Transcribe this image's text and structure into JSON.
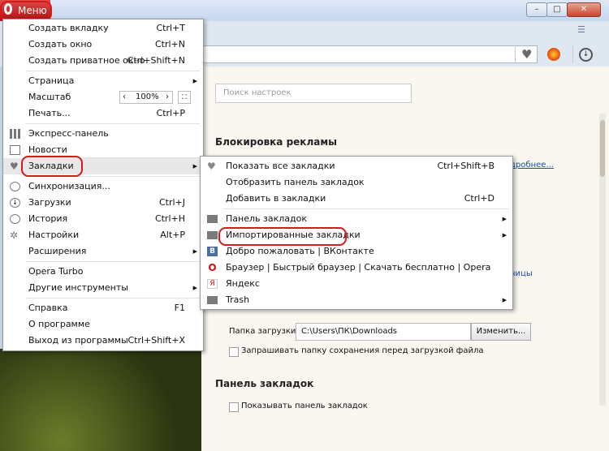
{
  "menu_button": {
    "label": "Меню"
  },
  "settings": {
    "search_placeholder": "Поиск настроек",
    "adblock_title": "Блокировка рекламы",
    "more_link": "Подробнее...",
    "frag_right": "ницы",
    "download_label": "Папка загрузки:",
    "download_path": "C:\\Users\\ПК\\Downloads",
    "change_button": "Изменить...",
    "ask_folder": "Запрашивать папку сохранения перед загрузкой файла",
    "bookmarks_panel_title": "Панель закладок",
    "show_bookmarks_panel": "Показывать панель закладок"
  },
  "main_menu": {
    "new_tab": "Создать вкладку",
    "new_tab_key": "Ctrl+T",
    "new_window": "Создать окно",
    "new_window_key": "Ctrl+N",
    "private_window": "Создать приватное окно",
    "private_window_key": "Ctrl+Shift+N",
    "page": "Страница",
    "zoom": "Масштаб",
    "zoom_value": "100%",
    "print": "Печать...",
    "print_key": "Ctrl+P",
    "speed_dial": "Экспресс-панель",
    "news": "Новости",
    "bookmarks": "Закладки",
    "sync": "Синхронизация...",
    "downloads": "Загрузки",
    "downloads_key": "Ctrl+J",
    "history": "История",
    "history_key": "Ctrl+H",
    "settings_item": "Настройки",
    "settings_key": "Alt+P",
    "extensions": "Расширения",
    "turbo": "Opera Turbo",
    "other_tools": "Другие инструменты",
    "help": "Справка",
    "help_key": "F1",
    "about": "О программе",
    "exit": "Выход из программы",
    "exit_key": "Ctrl+Shift+X"
  },
  "bookmarks_menu": {
    "show_all": "Показать все закладки",
    "show_all_key": "Ctrl+Shift+B",
    "show_panel": "Отобразить панель закладок",
    "add": "Добавить в закладки",
    "add_key": "Ctrl+D",
    "panel": "Панель закладок",
    "imported": "Импортированные закладки",
    "vk": "Добро пожаловать | ВКонтакте",
    "vk_icon_letter": "В",
    "opera": "Браузер | Быстрый браузер | Скачать бесплатно | Opera",
    "opera_icon_letter": "O",
    "yandex": "Яндекс",
    "yandex_icon_letter": "Я",
    "trash": "Trash"
  },
  "colors": {
    "highlight_ring": "#d41a1a",
    "opera_red": "#cc1111"
  }
}
